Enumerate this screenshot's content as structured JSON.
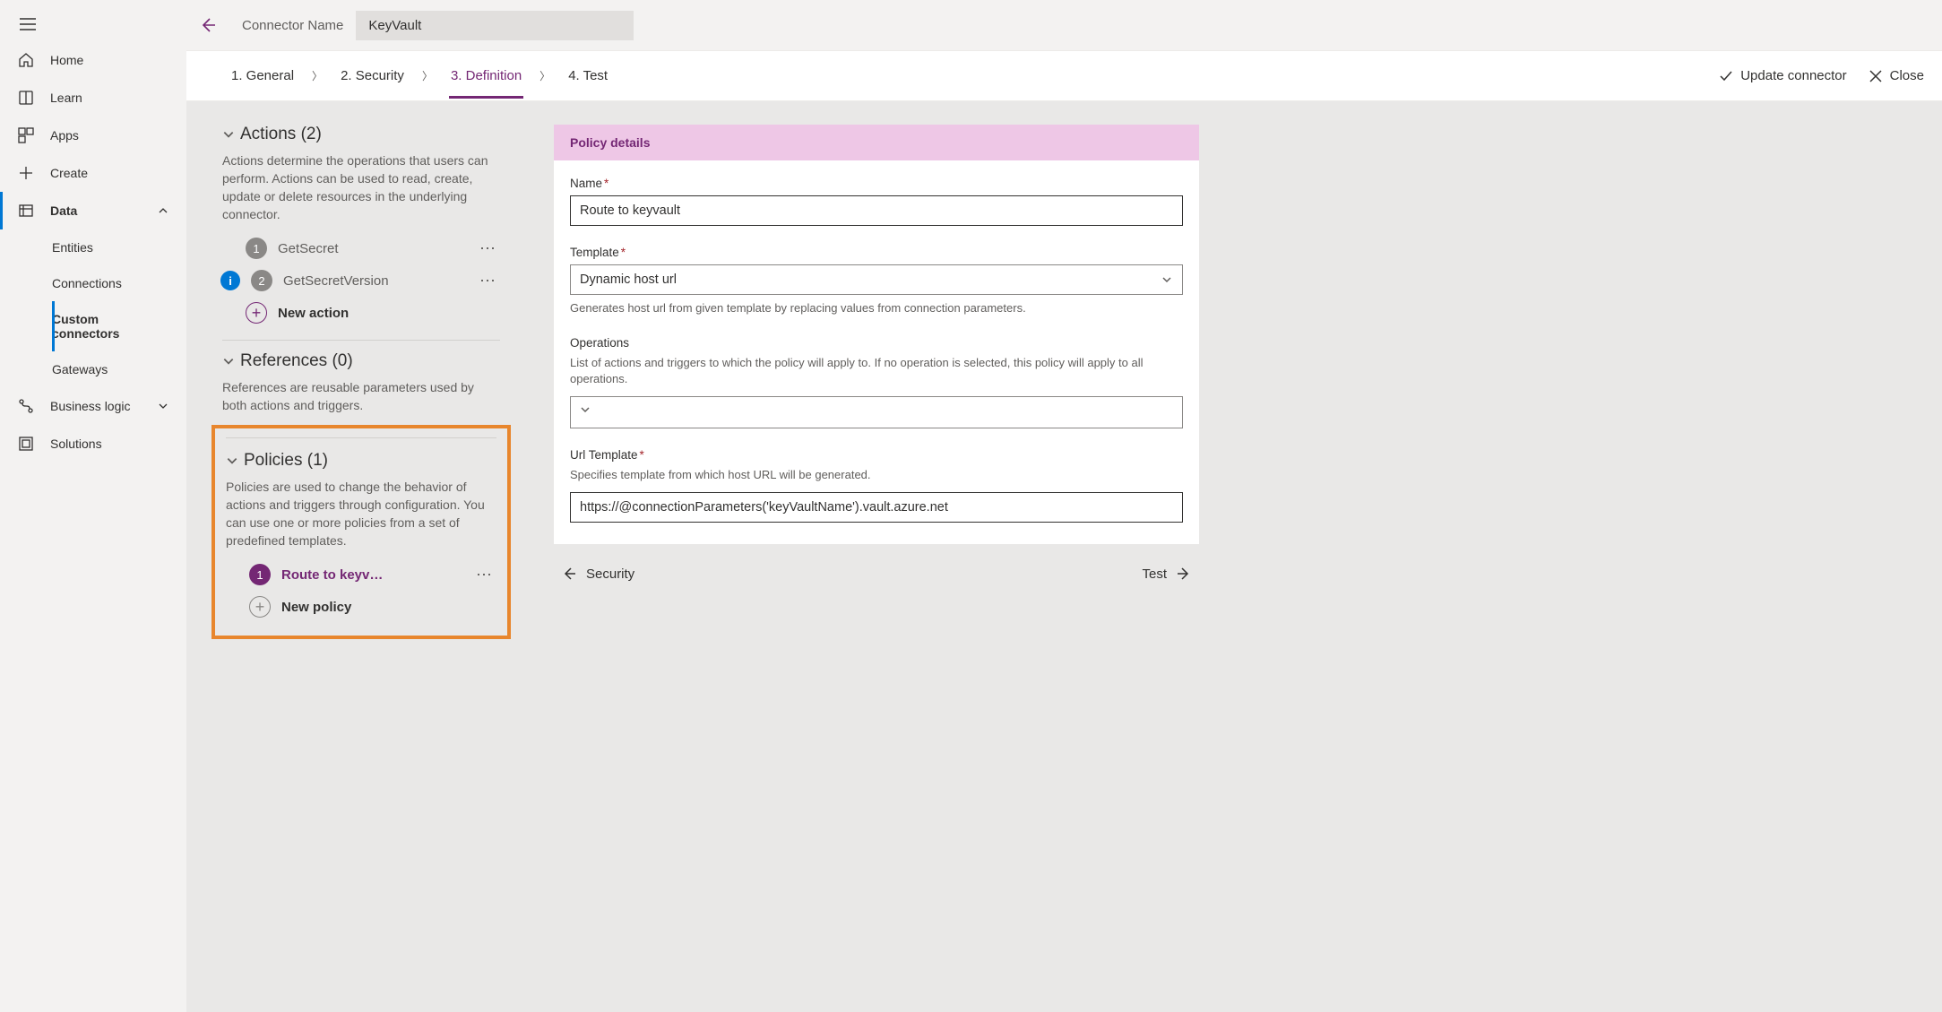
{
  "sidebar": {
    "items": [
      {
        "label": "Home"
      },
      {
        "label": "Learn"
      },
      {
        "label": "Apps"
      },
      {
        "label": "Create"
      },
      {
        "label": "Data",
        "expanded": true,
        "children": [
          {
            "label": "Entities"
          },
          {
            "label": "Connections"
          },
          {
            "label": "Custom connectors",
            "selected": true
          },
          {
            "label": "Gateways"
          }
        ]
      },
      {
        "label": "Business logic"
      },
      {
        "label": "Solutions"
      }
    ]
  },
  "topbar": {
    "connector_label": "Connector Name",
    "connector_value": "KeyVault"
  },
  "steps": {
    "items": [
      "1. General",
      "2. Security",
      "3. Definition",
      "4. Test"
    ],
    "active_index": 2,
    "update": "Update connector",
    "close": "Close"
  },
  "left": {
    "actions": {
      "title": "Actions (2)",
      "desc": "Actions determine the operations that users can perform. Actions can be used to read, create, update or delete resources in the underlying connector.",
      "items": [
        {
          "num": "1",
          "label": "GetSecret"
        },
        {
          "num": "2",
          "label": "GetSecretVersion",
          "info": true
        }
      ],
      "new": "New action"
    },
    "references": {
      "title": "References (0)",
      "desc": "References are reusable parameters used by both actions and triggers."
    },
    "policies": {
      "title": "Policies (1)",
      "desc": "Policies are used to change the behavior of actions and triggers through configuration. You can use one or more policies from a set of predefined templates.",
      "items": [
        {
          "num": "1",
          "label": "Route to keyv…"
        }
      ],
      "new": "New policy"
    }
  },
  "details": {
    "header": "Policy details",
    "name_label": "Name",
    "name_value": "Route to keyvault",
    "template_label": "Template",
    "template_value": "Dynamic host url",
    "template_help": "Generates host url from given template by replacing values from connection parameters.",
    "operations_label": "Operations",
    "operations_help": "List of actions and triggers to which the policy will apply to. If no operation is selected, this policy will apply to all operations.",
    "url_label": "Url Template",
    "url_help": "Specifies template from which host URL will be generated.",
    "url_value": "https://@connectionParameters('keyVaultName').vault.azure.net"
  },
  "footer": {
    "prev": "Security",
    "next": "Test"
  }
}
